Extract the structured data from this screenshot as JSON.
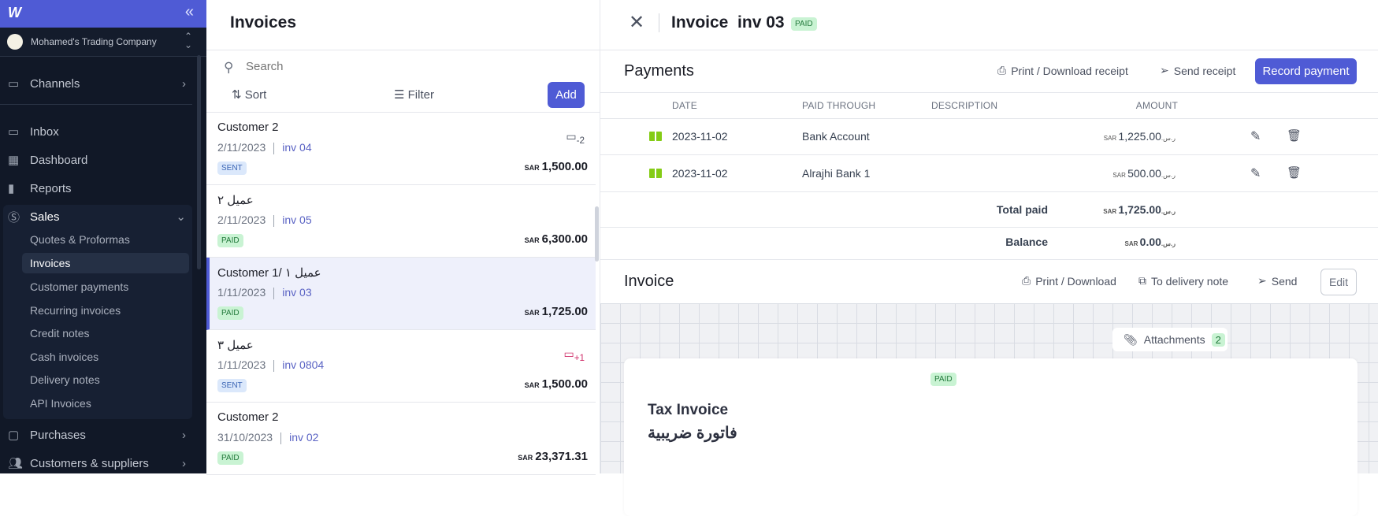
{
  "sidebar": {
    "company": "Mohamed's Trading Company",
    "items": {
      "channels": "Channels",
      "inbox": "Inbox",
      "dashboard": "Dashboard",
      "reports": "Reports",
      "sales": "Sales",
      "purchases": "Purchases",
      "customers": "Customers & suppliers"
    },
    "sales_sub": [
      "Quotes & Proformas",
      "Invoices",
      "Customer payments",
      "Recurring invoices",
      "Credit notes",
      "Cash invoices",
      "Delivery notes",
      "API Invoices"
    ]
  },
  "list": {
    "title": "Invoices",
    "search_placeholder": "Search",
    "sort": "Sort",
    "filter": "Filter",
    "add": "Add",
    "rows": [
      {
        "name": "Customer 2",
        "date": "2/11/2023",
        "number": "inv 04",
        "status": "SENT",
        "currency": "SAR",
        "amount": "1,500.00",
        "due": "-2"
      },
      {
        "name": "عميل ٢",
        "date": "2/11/2023",
        "number": "inv 05",
        "status": "PAID",
        "currency": "SAR",
        "amount": "6,300.00"
      },
      {
        "name": "Customer 1/ عميل ١",
        "date": "1/11/2023",
        "number": "inv 03",
        "status": "PAID",
        "currency": "SAR",
        "amount": "1,725.00"
      },
      {
        "name": "عميل ٣",
        "date": "1/11/2023",
        "number": "inv 0804",
        "status": "SENT",
        "currency": "SAR",
        "amount": "1,500.00",
        "due": "+1"
      },
      {
        "name": "Customer 2",
        "date": "31/10/2023",
        "number": "inv 02",
        "status": "PAID",
        "currency": "SAR",
        "amount": "23,371.31"
      }
    ]
  },
  "detail": {
    "title": "Invoice  inv 03",
    "status": "PAID",
    "payments": {
      "title": "Payments",
      "print": "Print / Download receipt",
      "send": "Send receipt",
      "record": "Record payment",
      "headers": {
        "date": "DATE",
        "through": "PAID THROUGH",
        "description": "DESCRIPTION",
        "amount": "AMOUNT"
      },
      "rows": [
        {
          "date": "2023-11-02",
          "through": "Bank Account",
          "description": "",
          "currency": "SAR ر.س.",
          "amount": "1,225.00"
        },
        {
          "date": "2023-11-02",
          "through": "Alrajhi Bank 1",
          "description": "",
          "currency": "SAR ر.س.",
          "amount": "500.00"
        }
      ],
      "total_label": "Total paid",
      "total_currency": "SAR ر.س.",
      "total": "1,725.00",
      "balance_label": "Balance",
      "balance_currency": "SAR ر.س.",
      "balance": "0.00"
    },
    "invoice": {
      "title": "Invoice",
      "print": "Print / Download",
      "delivery": "To delivery note",
      "send": "Send",
      "edit": "Edit",
      "attachments": "Attachments",
      "attachments_count": "2",
      "paper_status": "PAID",
      "tax_en": "Tax Invoice",
      "tax_ar": "فاتورة ضريبية"
    }
  }
}
